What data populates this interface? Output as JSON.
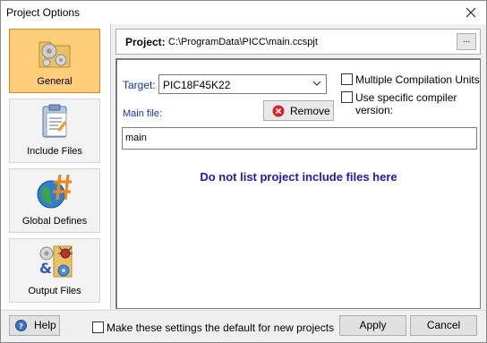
{
  "window": {
    "title": "Project Options"
  },
  "sidebar": {
    "items": [
      {
        "label": "General",
        "icon": "gears-folder-icon",
        "active": true
      },
      {
        "label": "Include Files",
        "icon": "clipboard-document-icon",
        "active": false
      },
      {
        "label": "Global Defines",
        "icon": "globe-hash-icon",
        "active": false
      },
      {
        "label": "Output Files",
        "icon": "gears-bug-folder-icon",
        "active": false
      }
    ]
  },
  "project": {
    "label": "Project:",
    "path": "C:\\ProgramData\\PICC\\main.ccspjt",
    "browse_label": "..."
  },
  "general": {
    "target_label": "Target:",
    "target_value": "PIC18F45K22",
    "multiple_units_label": "Multiple Compilation Units",
    "specific_compiler_label": "Use specific compiler version:",
    "main_file_label": "Main file:",
    "remove_label": "Remove",
    "main_file_value": "main",
    "notice": "Do not list project include files here"
  },
  "footer": {
    "help_label": "Help",
    "default_label": "Make these settings the default for new projects",
    "apply_label": "Apply",
    "cancel_label": "Cancel"
  },
  "colors": {
    "accent_label": "#1533a3",
    "notice": "#1f1aa8",
    "active_nav": "#fdcd7a",
    "remove_icon": "#d9232e"
  }
}
